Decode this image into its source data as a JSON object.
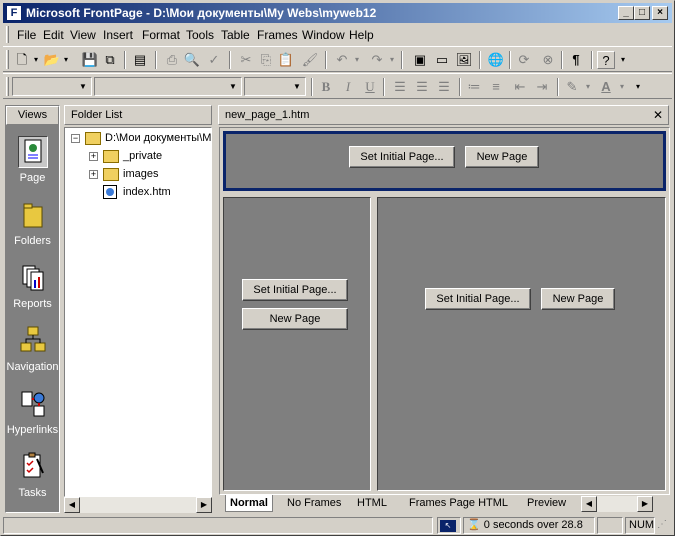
{
  "titlebar": {
    "title": "Microsoft FrontPage - D:\\Мои документы\\My Webs\\myweb12",
    "minimize_icon": "minimize-icon",
    "maximize_icon": "maximize-icon",
    "close_icon": "close-icon"
  },
  "menu": [
    "File",
    "Edit",
    "View",
    "Insert",
    "Format",
    "Tools",
    "Table",
    "Frames",
    "Window",
    "Help"
  ],
  "formatting": {
    "style_value": "",
    "font_value": "",
    "size_value": ""
  },
  "views": {
    "header": "Views",
    "items": [
      {
        "label": "Page",
        "icon": "page-view-icon"
      },
      {
        "label": "Folders",
        "icon": "folders-view-icon"
      },
      {
        "label": "Reports",
        "icon": "reports-view-icon"
      },
      {
        "label": "Navigation",
        "icon": "navigation-view-icon"
      },
      {
        "label": "Hyperlinks",
        "icon": "hyperlinks-view-icon"
      },
      {
        "label": "Tasks",
        "icon": "tasks-view-icon"
      }
    ]
  },
  "folder_list": {
    "header": "Folder List",
    "root": "D:\\Мои документы\\M",
    "items": [
      {
        "label": "_private",
        "type": "folder"
      },
      {
        "label": "images",
        "type": "folder"
      },
      {
        "label": "index.htm",
        "type": "file"
      }
    ]
  },
  "editor": {
    "doc_title": "new_page_1.htm",
    "set_initial_label": "Set Initial Page...",
    "new_page_label": "New Page"
  },
  "view_tabs": [
    "Normal",
    "No Frames",
    "HTML",
    "Frames Page HTML",
    "Preview"
  ],
  "status": {
    "timing": "0 seconds over 28.8",
    "num": "NUM"
  },
  "colors": {
    "titlebar_start": "#0a246a",
    "titlebar_end": "#a6caf0",
    "frame_bg": "#7f7f7f",
    "face": "#d4d0c8"
  }
}
